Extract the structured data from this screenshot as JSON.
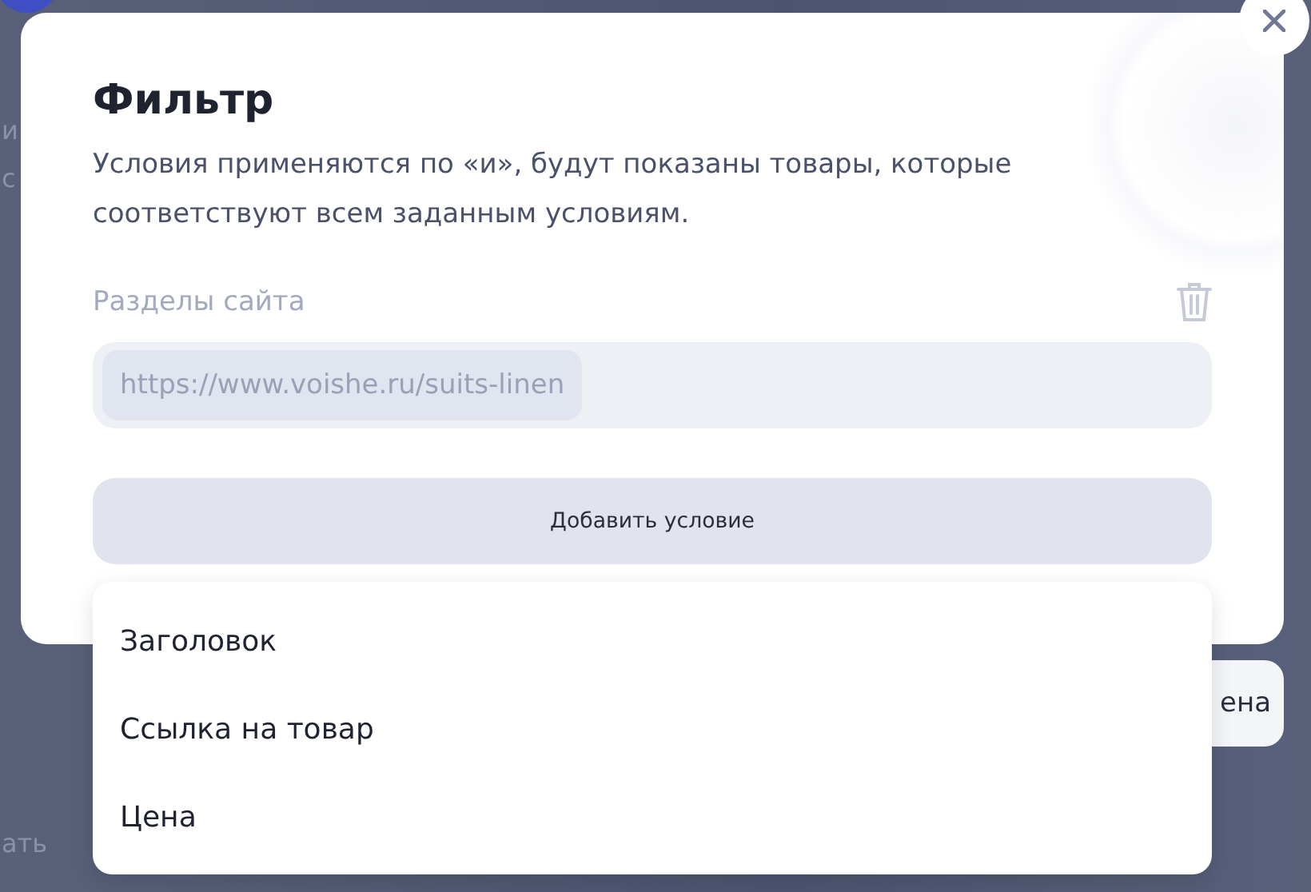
{
  "background": {
    "texts": [
      "и",
      "с",
      "ать"
    ],
    "button": "ена"
  },
  "modal": {
    "title": "Фильтр",
    "description": "Условия применяются по «и», будут показаны товары, которые соответствуют всем заданным условиям.",
    "condition": {
      "label": "Разделы сайта",
      "values": [
        "https://www.voishe.ru/suits-linen"
      ]
    },
    "add_button": "Добавить условие"
  },
  "dropdown": {
    "items": [
      {
        "label": "Заголовок"
      },
      {
        "label": "Ссылка на товар"
      },
      {
        "label": "Цена"
      }
    ]
  }
}
